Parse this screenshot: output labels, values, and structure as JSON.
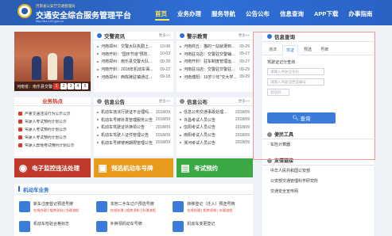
{
  "header": {
    "subtitle": "河南省公安厅交通管理局",
    "title": "交通安全综合服务管理平台",
    "url": "http://ha.122.gov.cn"
  },
  "nav": [
    "首页",
    "业务办理",
    "服务导航",
    "公告公布",
    "信息查询",
    "APP下载",
    "办事指南"
  ],
  "carousel": {
    "caption": "河南省：南乐县交警大队走进学校",
    "pages": [
      "1",
      "2",
      "3",
      "4",
      "5"
    ]
  },
  "news": {
    "title": "交警资讯",
    "more": "更多>>",
    "items": [
      {
        "text": "河南郑州：交警大队执勤上...",
        "date": "10-08"
      },
      {
        "text": "河南开封：\"国庆节道\"预防...",
        "date": "10-03"
      },
      {
        "text": "河南郑州：南乐县交警大队...",
        "date": "09-28"
      },
      {
        "text": "河南开封：2018年机动车保...",
        "date": "09-22"
      },
      {
        "text": "河南郑州：西陈陵驻镇通过...",
        "date": "09-18"
      }
    ]
  },
  "education": {
    "title": "警示教育",
    "more": "更多>>",
    "items": [
      {
        "text": "河南商丘：猫的一站就遭到...",
        "date": "09-29"
      },
      {
        "text": "河南驻马店：交警驻交警辅...",
        "date": "09-27"
      },
      {
        "text": "河南开封：驻车制度管理运...",
        "date": "09-27"
      },
      {
        "text": "河南驻马店：交警驻交警驻...",
        "date": "09-29"
      },
      {
        "text": "河南濮阳：19岁少年\"交大学...",
        "date": "09-29"
      }
    ]
  },
  "hot": {
    "title": "业务热点",
    "items": [
      "严重交通违法行为公示公示",
      "驾驶人考试预约计划公示",
      "驾驶人考试预约计划公示",
      "驾驶人考试预约计划公示",
      "驾驶人异地考试预约计划公示"
    ]
  },
  "notices": {
    "title": "信息公告",
    "more": "更多>>",
    "items": [
      {
        "text": "机动车违法行驶证不合理吗...",
        "date": "2018/09"
      },
      {
        "text": "机动车号牌补发管理服务公告",
        "date": "2018/09"
      },
      {
        "text": "机动车驾驶证补换领公告",
        "date": "2018/09"
      },
      {
        "text": "机动车驾驶人证件管理公告",
        "date": "2018/09"
      },
      {
        "text": "机动车号牌使用期限管理公告",
        "date": "2018/09"
      }
    ]
  },
  "notices2": {
    "title": "信息公布",
    "more": "更多>>",
    "items": [
      {
        "text": "信息公布交通事故处理...",
        "date": "2018/09"
      },
      {
        "text": "许昌考试人员公告",
        "date": "2018/09"
      },
      {
        "text": "信阳考试人员公告",
        "date": "2018/09"
      },
      {
        "text": "南阳考试人员公告",
        "date": "2018/09"
      },
      {
        "text": "漯河考试人员公告",
        "date": "2018/09"
      }
    ]
  },
  "banners": [
    {
      "label": "电子监控违法处理",
      "color": "#c0392b"
    },
    {
      "label": "预选机动车号牌",
      "color": "#e89a1b"
    },
    {
      "label": "考试预约",
      "color": "#3aa845"
    }
  ],
  "business": {
    "title": "机动车业务",
    "items": [
      {
        "title": "新车注册登记预选号牌",
        "links": "在线办理 | 相关须知 | 办理流程"
      },
      {
        "title": "本地二手车过户预选号牌",
        "links": "在线办理 | 相关须知 | 办理流程"
      },
      {
        "title": "转移登记（迁入）预选号牌",
        "links": "在线办理 | 相关须知 | 办理流程"
      }
    ],
    "row2": [
      "机动车检验合格标志",
      "补换领机动车号牌",
      "机动车变更登记"
    ]
  },
  "sidebar": {
    "title": "信息查询",
    "tabs": [
      "违法",
      "驾证",
      "预选",
      "号牌"
    ],
    "form_label": "驾驶证记分查询",
    "fields": {
      "license_placeholder": "请输入驾驶证号码",
      "file_placeholder": "请输入驾驶证档案编号",
      "code_placeholder": "验证码"
    },
    "query_button": "查询",
    "tools_title": "便民工具",
    "tools": [
      "车险计算器"
    ],
    "links_title": "友情链接",
    "links": [
      "中华人民共和国公安部",
      "公安部交通管理科学研究所",
      "交通安全宣传网"
    ]
  }
}
